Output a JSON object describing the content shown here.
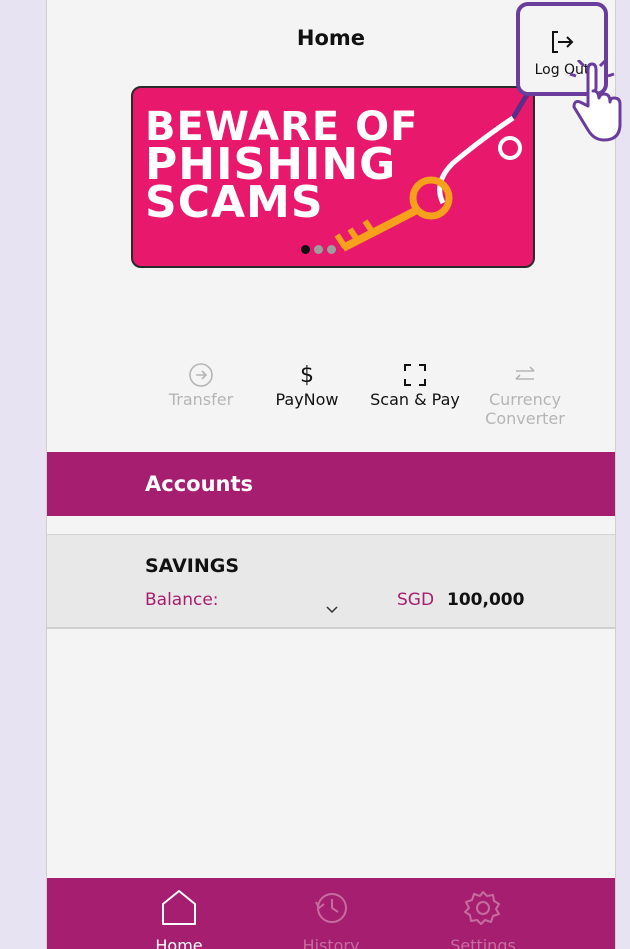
{
  "header": {
    "title": "Home"
  },
  "logout": {
    "label": "Log Out"
  },
  "banner": {
    "lines": [
      "BEWARE OF",
      "PHISHING",
      "SCAMS"
    ]
  },
  "actions": [
    {
      "label": "Transfer",
      "enabled": false
    },
    {
      "label": "PayNow",
      "enabled": true
    },
    {
      "label": "Scan & Pay",
      "enabled": true
    },
    {
      "label": "Currency Converter",
      "enabled": false
    }
  ],
  "accounts": {
    "heading": "Accounts",
    "items": [
      {
        "name": "SAVINGS",
        "balance_label": "Balance:",
        "currency": "SGD",
        "amount": "100,000"
      }
    ]
  },
  "nav": {
    "home": "Home",
    "history": "History",
    "settings": "Settings"
  },
  "colors": {
    "brand": "#a61e6f",
    "banner": "#e8196d",
    "highlight": "#6a3c9c",
    "key": "#f7a01c"
  }
}
